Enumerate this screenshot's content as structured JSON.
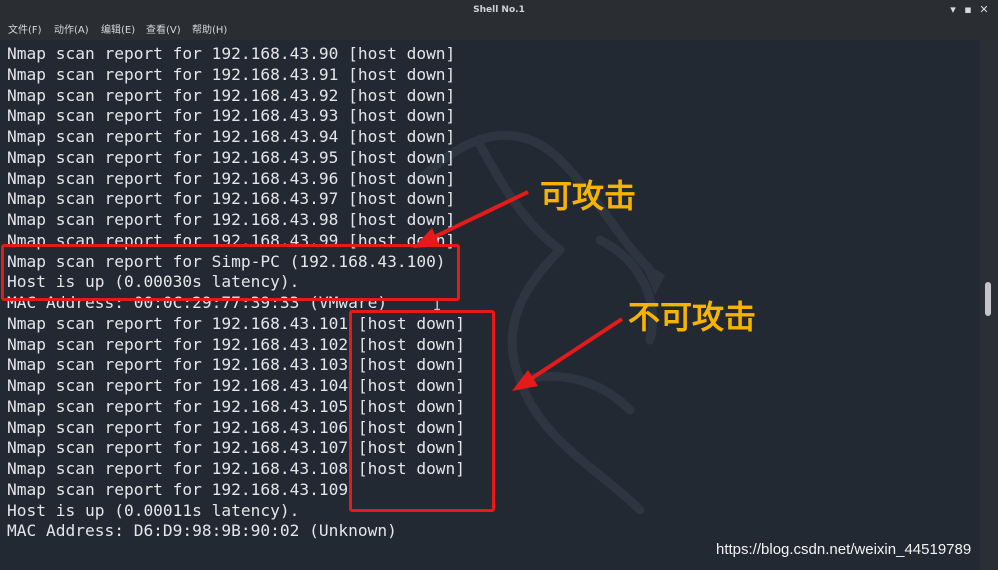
{
  "window": {
    "title": "Shell No.1",
    "minimize_glyph": "▾",
    "restore_glyph": "▪",
    "close_glyph": "✕"
  },
  "menu": [
    {
      "label": "文件(F)"
    },
    {
      "label": "动作(A)"
    },
    {
      "label": "编辑(E)"
    },
    {
      "label": "查看(V)"
    },
    {
      "label": "帮助(H)"
    }
  ],
  "terminal": {
    "lines": [
      "Nmap scan report for 192.168.43.90 [host down]",
      "Nmap scan report for 192.168.43.91 [host down]",
      "Nmap scan report for 192.168.43.92 [host down]",
      "Nmap scan report for 192.168.43.93 [host down]",
      "Nmap scan report for 192.168.43.94 [host down]",
      "Nmap scan report for 192.168.43.95 [host down]",
      "Nmap scan report for 192.168.43.96 [host down]",
      "Nmap scan report for 192.168.43.97 [host down]",
      "Nmap scan report for 192.168.43.98 [host down]",
      "Nmap scan report for 192.168.43.99 [host down]",
      "Nmap scan report for Simp-PC (192.168.43.100)",
      "Host is up (0.00030s latency).",
      "MAC Address: 00:0C:29:77:39:33 (VMware)",
      "Nmap scan report for 192.168.43.101 [host down]",
      "Nmap scan report for 192.168.43.102 [host down]",
      "Nmap scan report for 192.168.43.103 [host down]",
      "Nmap scan report for 192.168.43.104 [host down]",
      "Nmap scan report for 192.168.43.105 [host down]",
      "Nmap scan report for 192.168.43.106 [host down]",
      "Nmap scan report for 192.168.43.107 [host down]",
      "Nmap scan report for 192.168.43.108 [host down]",
      "Nmap scan report for 192.168.43.109",
      "Host is up (0.00011s latency).",
      "MAC Address: D6:D9:98:9B:90:02 (Unknown)"
    ],
    "cursor_glyph": "I"
  },
  "annotations": {
    "attackable_label": "可攻击",
    "not_attackable_label": "不可攻击",
    "color": "#e51a1a",
    "label_color": "#f6b300"
  },
  "watermark": "https://blog.csdn.net/weixin_44519789"
}
